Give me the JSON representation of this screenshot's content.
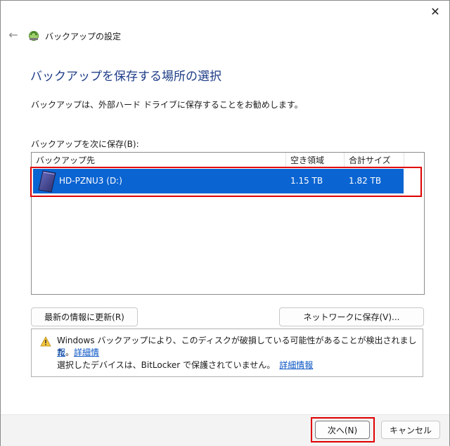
{
  "window": {
    "title": "バックアップの設定",
    "close_glyph": "✕",
    "back_glyph": "←"
  },
  "page": {
    "heading": "バックアップを保存する場所の選択",
    "description": "バックアップは、外部ハード ドライブに保存することをお勧めします。",
    "list_label": "バックアップを次に保存(B):"
  },
  "list": {
    "columns": [
      "バックアップ先",
      "空き領域",
      "合計サイズ"
    ],
    "rows": [
      {
        "name": "HD-PZNU3 (D:)",
        "free": "1.15 TB",
        "total": "1.82 TB",
        "selected": true
      }
    ]
  },
  "buttons": {
    "refresh": "最新の情報に更新(R)",
    "network_save": "ネットワークに保存(V)...",
    "next": "次へ(N)",
    "cancel": "キャンセル"
  },
  "warning": {
    "line1": "Windows バックアップにより、このディスクが破損している可能性があることが検出されました。",
    "link1": "詳細情",
    "link1_cont": "報",
    "line2": "選択したデバイスは、BitLocker で保護されていません。",
    "link2": "詳細情報"
  },
  "colors": {
    "selection": "#0a64d2",
    "heading": "#1e3c87",
    "highlight_box": "#e00000",
    "link": "#0b55c4"
  }
}
